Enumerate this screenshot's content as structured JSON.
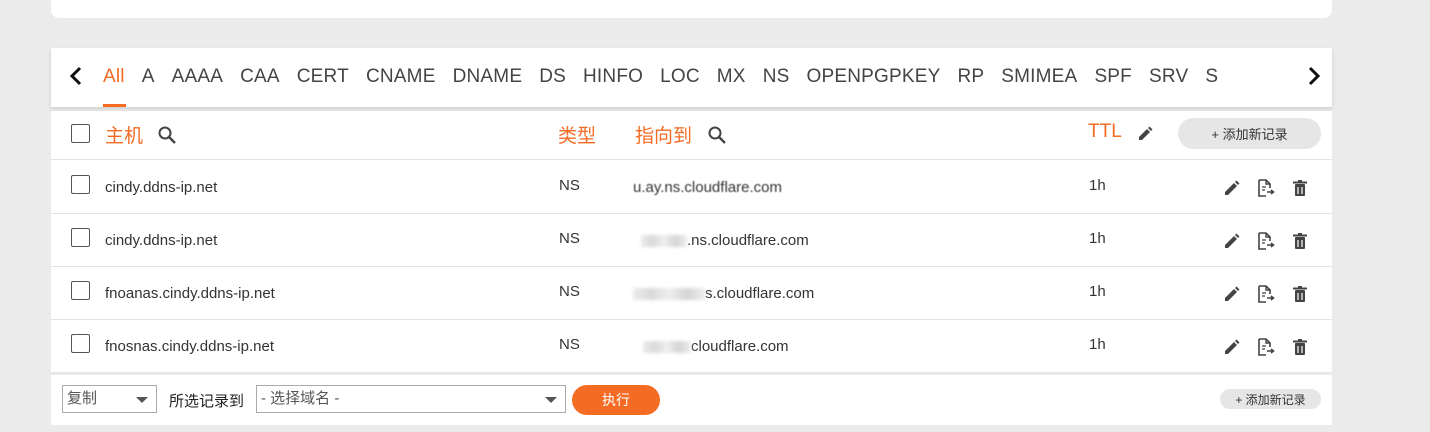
{
  "tabs": {
    "prev_icon": "chevron-left-icon",
    "next_icon": "chevron-right-icon",
    "items": [
      "All",
      "A",
      "AAAA",
      "CAA",
      "CERT",
      "CNAME",
      "DNAME",
      "DS",
      "HINFO",
      "LOC",
      "MX",
      "NS",
      "OPENPGPKEY",
      "RP",
      "SMIMEA",
      "SPF",
      "SRV",
      "S"
    ],
    "active": "All"
  },
  "table": {
    "headers": {
      "host": "主机",
      "type": "类型",
      "target": "指向到",
      "ttl": "TTL"
    },
    "add_record_label": "+ 添加新记录",
    "rows": [
      {
        "host": "cindy.ddns-ip.net",
        "type": "NS",
        "target_visible": "u.ay.ns.cloudflare.com",
        "ttl": "1h"
      },
      {
        "host": "cindy.ddns-ip.net",
        "type": "NS",
        "target_visible": ".ns.cloudflare.com",
        "ttl": "1h"
      },
      {
        "host": "fnoanas.cindy.ddns-ip.net",
        "type": "NS",
        "target_visible": "s.cloudflare.com",
        "ttl": "1h"
      },
      {
        "host": "fnosnas.cindy.ddns-ip.net",
        "type": "NS",
        "target_visible": "cloudflare.com",
        "ttl": "1h"
      }
    ]
  },
  "footer": {
    "action_select_value": "复制",
    "selected_records_label": "所选记录到",
    "domain_select_placeholder": "- 选择域名 -",
    "execute_label": "执行",
    "add_record_label": "+ 添加新记录"
  },
  "colors": {
    "accent": "#f46b24",
    "background": "#ebebeb"
  }
}
